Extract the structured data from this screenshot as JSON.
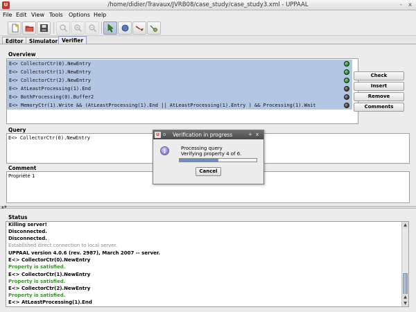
{
  "window": {
    "title": "/home/didier/Travaux/JVRB08/case_study/case_study3.xml - UPPAAL",
    "controls": [
      "-",
      "x"
    ]
  },
  "menu": [
    "File",
    "Edit",
    "View",
    "Tools",
    "Options",
    "Help"
  ],
  "toolbar": {
    "buttons": [
      {
        "name": "new-icon",
        "state": "normal"
      },
      {
        "name": "open-icon",
        "state": "normal"
      },
      {
        "name": "save-icon",
        "state": "normal"
      },
      {
        "name": "zoom-fit-icon",
        "state": "disabled"
      },
      {
        "name": "zoom-in-icon",
        "state": "disabled"
      },
      {
        "name": "zoom-out-icon",
        "state": "disabled"
      },
      {
        "name": "select-tool-icon",
        "state": "pressed"
      },
      {
        "name": "location-tool-icon",
        "state": "normal"
      },
      {
        "name": "edge-tool-icon",
        "state": "normal"
      },
      {
        "name": "nail-tool-icon",
        "state": "normal"
      }
    ]
  },
  "tabs": [
    "Editor",
    "Simulator",
    "Verifier"
  ],
  "overview": {
    "label": "Overview",
    "rows": [
      {
        "text": "E<> CollectorCtr(0).NewEntry",
        "status": "green"
      },
      {
        "text": "E<> CollectorCtr(1).NewEntry",
        "status": "green"
      },
      {
        "text": "E<> CollectorCtr(2).NewEntry",
        "status": "green"
      },
      {
        "text": "E<> AtLeastProcessing(1).End",
        "status": "grey"
      },
      {
        "text": "E<> BothProcessing(0).Buffer2",
        "status": "grey"
      },
      {
        "text": "E<> MemoryCtr(1).Write && (AtLeastProcessing(1).End || AtLeastProcessing(1).Entry ) && Processing(1).Wait",
        "status": "grey"
      }
    ],
    "buttons": [
      "Check",
      "Insert",
      "Remove",
      "Comments"
    ]
  },
  "query": {
    "label": "Query",
    "value": "E<> CollectorCtr(0).NewEntry"
  },
  "comment": {
    "label": "Comment",
    "value": "Propriété 1"
  },
  "dialog": {
    "title": "Verification in progress",
    "line1": "Processing query",
    "line2": "Verifying property 4 of 6.",
    "progress": 0.5,
    "cancel": "Cancel",
    "title_controls": [
      "+",
      "x"
    ]
  },
  "status": {
    "label": "Status",
    "lines": [
      {
        "text": "Killing server!",
        "style": "normal"
      },
      {
        "text": "Disconnected.",
        "style": "normal"
      },
      {
        "text": "Disconnected.",
        "style": "normal"
      },
      {
        "text": "Established direct connection to local server.",
        "style": "grey"
      },
      {
        "text": "UPPAAL version 4.0.6 (rev. 2987), March 2007 -- server.",
        "style": "normal"
      },
      {
        "text": "E<> CollectorCtr(0).NewEntry",
        "style": "normal"
      },
      {
        "text": "Property is satisfied.",
        "style": "green"
      },
      {
        "text": "E<> CollectorCtr(1).NewEntry",
        "style": "normal"
      },
      {
        "text": "Property is satisfied.",
        "style": "green"
      },
      {
        "text": "E<> CollectorCtr(2).NewEntry",
        "style": "normal"
      },
      {
        "text": "Property is satisfied.",
        "style": "green"
      },
      {
        "text": "E<> AtLeastProcessing(1).End",
        "style": "normal"
      }
    ]
  },
  "colors": {
    "selection": "#b4c7e2",
    "satisfied": "#2e9a1e"
  }
}
